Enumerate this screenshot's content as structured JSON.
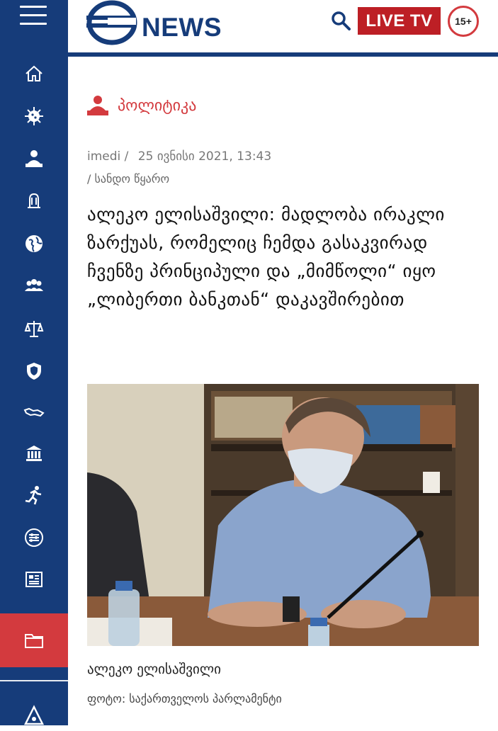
{
  "header": {
    "logo_text": "NEWS",
    "live_label": "LIVE TV",
    "age_rating": "15+"
  },
  "sidebar": {
    "icons": [
      "home-icon",
      "virus-icon",
      "politics-icon",
      "economy-icon",
      "globe-icon",
      "society-icon",
      "justice-icon",
      "security-icon",
      "map-icon",
      "culture-icon",
      "sport-icon",
      "technology-icon",
      "press-icon",
      "folder-icon",
      "bell-icon"
    ]
  },
  "article": {
    "category": "პოლიტიკა",
    "source": "imedi /",
    "date": "25 ივნისი 2021, 13:43",
    "source_note": "/ სანდო წყარო",
    "title": "ალეკო ელისაშვილი: მადლობა ირაკლი ზარქუას, რომელიც ჩემდა გასაკვირად ჩვენზე პრინციპული და „მიმწოლი“ იყო „ლიბერთი ბანკთან“ დაკავშირებით",
    "caption": "ალეკო ელისაშვილი",
    "photo_credit": "ფოტო: საქართველოს პარლამენტი"
  },
  "colors": {
    "brand_blue": "#163c7a",
    "accent_red": "#d33a3e",
    "live_red": "#bd1f25"
  }
}
